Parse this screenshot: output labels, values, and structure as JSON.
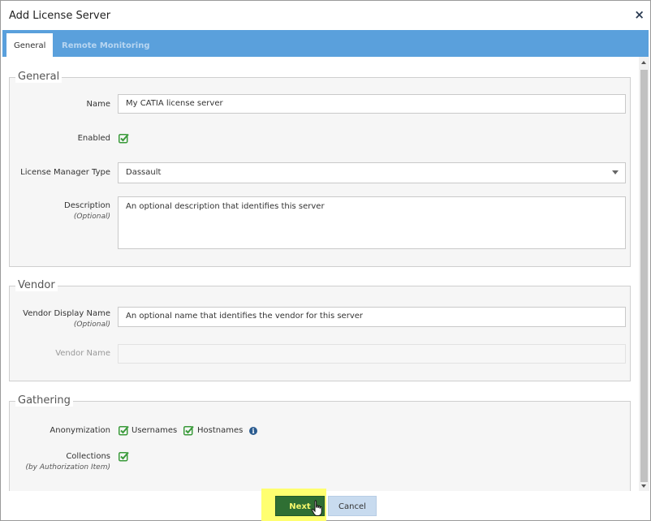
{
  "dialog": {
    "title": "Add License Server",
    "close_symbol": "×"
  },
  "tabs": [
    {
      "label": "General",
      "active": true
    },
    {
      "label": "Remote Monitoring",
      "active": false
    }
  ],
  "general": {
    "legend": "General",
    "name_label": "Name",
    "name_value": "My CATIA license server",
    "enabled_label": "Enabled",
    "enabled_checked": true,
    "license_manager_type_label": "License Manager Type",
    "license_manager_type_value": "Dassault",
    "description_label": "Description",
    "description_sub": "(Optional)",
    "description_placeholder": "An optional description that identifies this server"
  },
  "vendor": {
    "legend": "Vendor",
    "display_name_label": "Vendor Display Name",
    "display_name_sub": "(Optional)",
    "display_name_placeholder": "An optional name that identifies the vendor for this server",
    "vendor_name_label": "Vendor Name",
    "vendor_name_value": ""
  },
  "gathering": {
    "legend": "Gathering",
    "anonymization_label": "Anonymization",
    "usernames_label": "Usernames",
    "usernames_checked": true,
    "hostnames_label": "Hostnames",
    "hostnames_checked": true,
    "info_symbol": "i",
    "collections_label": "Collections",
    "collections_sub": "(by Authorization Item)",
    "collections_checked": true
  },
  "footer": {
    "next_label": "Next",
    "cancel_label": "Cancel"
  },
  "colors": {
    "tab_bar": "#5aa0dc",
    "checkbox_green": "#3a9a3a",
    "next_button": "#2f6f33",
    "next_text": "#f6f66c",
    "cancel_button": "#c8dbef",
    "highlight": "#ffff70"
  }
}
